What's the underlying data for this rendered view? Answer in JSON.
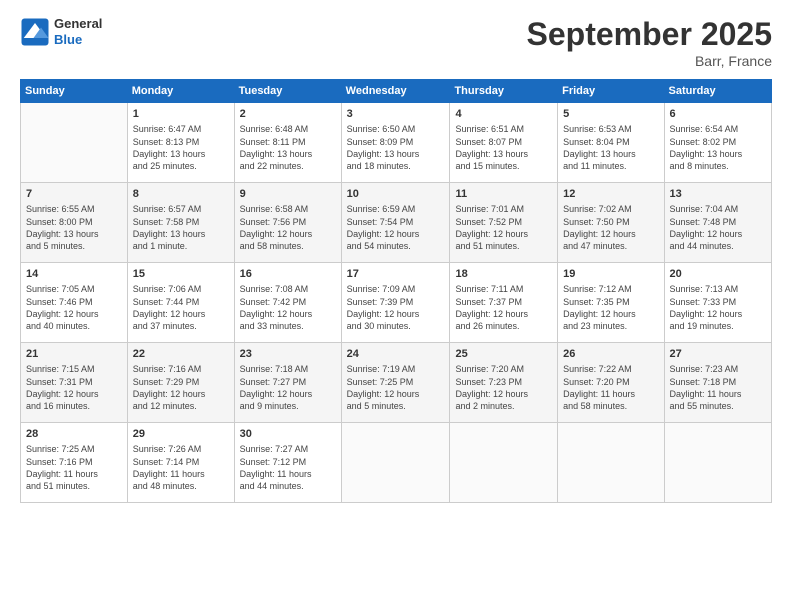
{
  "header": {
    "logo": {
      "general": "General",
      "blue": "Blue"
    },
    "title": "September 2025",
    "location": "Barr, France"
  },
  "days": [
    "Sunday",
    "Monday",
    "Tuesday",
    "Wednesday",
    "Thursday",
    "Friday",
    "Saturday"
  ],
  "weeks": [
    [
      {
        "day": "",
        "text": ""
      },
      {
        "day": "1",
        "text": "Sunrise: 6:47 AM\nSunset: 8:13 PM\nDaylight: 13 hours\nand 25 minutes."
      },
      {
        "day": "2",
        "text": "Sunrise: 6:48 AM\nSunset: 8:11 PM\nDaylight: 13 hours\nand 22 minutes."
      },
      {
        "day": "3",
        "text": "Sunrise: 6:50 AM\nSunset: 8:09 PM\nDaylight: 13 hours\nand 18 minutes."
      },
      {
        "day": "4",
        "text": "Sunrise: 6:51 AM\nSunset: 8:07 PM\nDaylight: 13 hours\nand 15 minutes."
      },
      {
        "day": "5",
        "text": "Sunrise: 6:53 AM\nSunset: 8:04 PM\nDaylight: 13 hours\nand 11 minutes."
      },
      {
        "day": "6",
        "text": "Sunrise: 6:54 AM\nSunset: 8:02 PM\nDaylight: 13 hours\nand 8 minutes."
      }
    ],
    [
      {
        "day": "7",
        "text": "Sunrise: 6:55 AM\nSunset: 8:00 PM\nDaylight: 13 hours\nand 5 minutes."
      },
      {
        "day": "8",
        "text": "Sunrise: 6:57 AM\nSunset: 7:58 PM\nDaylight: 13 hours\nand 1 minute."
      },
      {
        "day": "9",
        "text": "Sunrise: 6:58 AM\nSunset: 7:56 PM\nDaylight: 12 hours\nand 58 minutes."
      },
      {
        "day": "10",
        "text": "Sunrise: 6:59 AM\nSunset: 7:54 PM\nDaylight: 12 hours\nand 54 minutes."
      },
      {
        "day": "11",
        "text": "Sunrise: 7:01 AM\nSunset: 7:52 PM\nDaylight: 12 hours\nand 51 minutes."
      },
      {
        "day": "12",
        "text": "Sunrise: 7:02 AM\nSunset: 7:50 PM\nDaylight: 12 hours\nand 47 minutes."
      },
      {
        "day": "13",
        "text": "Sunrise: 7:04 AM\nSunset: 7:48 PM\nDaylight: 12 hours\nand 44 minutes."
      }
    ],
    [
      {
        "day": "14",
        "text": "Sunrise: 7:05 AM\nSunset: 7:46 PM\nDaylight: 12 hours\nand 40 minutes."
      },
      {
        "day": "15",
        "text": "Sunrise: 7:06 AM\nSunset: 7:44 PM\nDaylight: 12 hours\nand 37 minutes."
      },
      {
        "day": "16",
        "text": "Sunrise: 7:08 AM\nSunset: 7:42 PM\nDaylight: 12 hours\nand 33 minutes."
      },
      {
        "day": "17",
        "text": "Sunrise: 7:09 AM\nSunset: 7:39 PM\nDaylight: 12 hours\nand 30 minutes."
      },
      {
        "day": "18",
        "text": "Sunrise: 7:11 AM\nSunset: 7:37 PM\nDaylight: 12 hours\nand 26 minutes."
      },
      {
        "day": "19",
        "text": "Sunrise: 7:12 AM\nSunset: 7:35 PM\nDaylight: 12 hours\nand 23 minutes."
      },
      {
        "day": "20",
        "text": "Sunrise: 7:13 AM\nSunset: 7:33 PM\nDaylight: 12 hours\nand 19 minutes."
      }
    ],
    [
      {
        "day": "21",
        "text": "Sunrise: 7:15 AM\nSunset: 7:31 PM\nDaylight: 12 hours\nand 16 minutes."
      },
      {
        "day": "22",
        "text": "Sunrise: 7:16 AM\nSunset: 7:29 PM\nDaylight: 12 hours\nand 12 minutes."
      },
      {
        "day": "23",
        "text": "Sunrise: 7:18 AM\nSunset: 7:27 PM\nDaylight: 12 hours\nand 9 minutes."
      },
      {
        "day": "24",
        "text": "Sunrise: 7:19 AM\nSunset: 7:25 PM\nDaylight: 12 hours\nand 5 minutes."
      },
      {
        "day": "25",
        "text": "Sunrise: 7:20 AM\nSunset: 7:23 PM\nDaylight: 12 hours\nand 2 minutes."
      },
      {
        "day": "26",
        "text": "Sunrise: 7:22 AM\nSunset: 7:20 PM\nDaylight: 11 hours\nand 58 minutes."
      },
      {
        "day": "27",
        "text": "Sunrise: 7:23 AM\nSunset: 7:18 PM\nDaylight: 11 hours\nand 55 minutes."
      }
    ],
    [
      {
        "day": "28",
        "text": "Sunrise: 7:25 AM\nSunset: 7:16 PM\nDaylight: 11 hours\nand 51 minutes."
      },
      {
        "day": "29",
        "text": "Sunrise: 7:26 AM\nSunset: 7:14 PM\nDaylight: 11 hours\nand 48 minutes."
      },
      {
        "day": "30",
        "text": "Sunrise: 7:27 AM\nSunset: 7:12 PM\nDaylight: 11 hours\nand 44 minutes."
      },
      {
        "day": "",
        "text": ""
      },
      {
        "day": "",
        "text": ""
      },
      {
        "day": "",
        "text": ""
      },
      {
        "day": "",
        "text": ""
      }
    ]
  ]
}
